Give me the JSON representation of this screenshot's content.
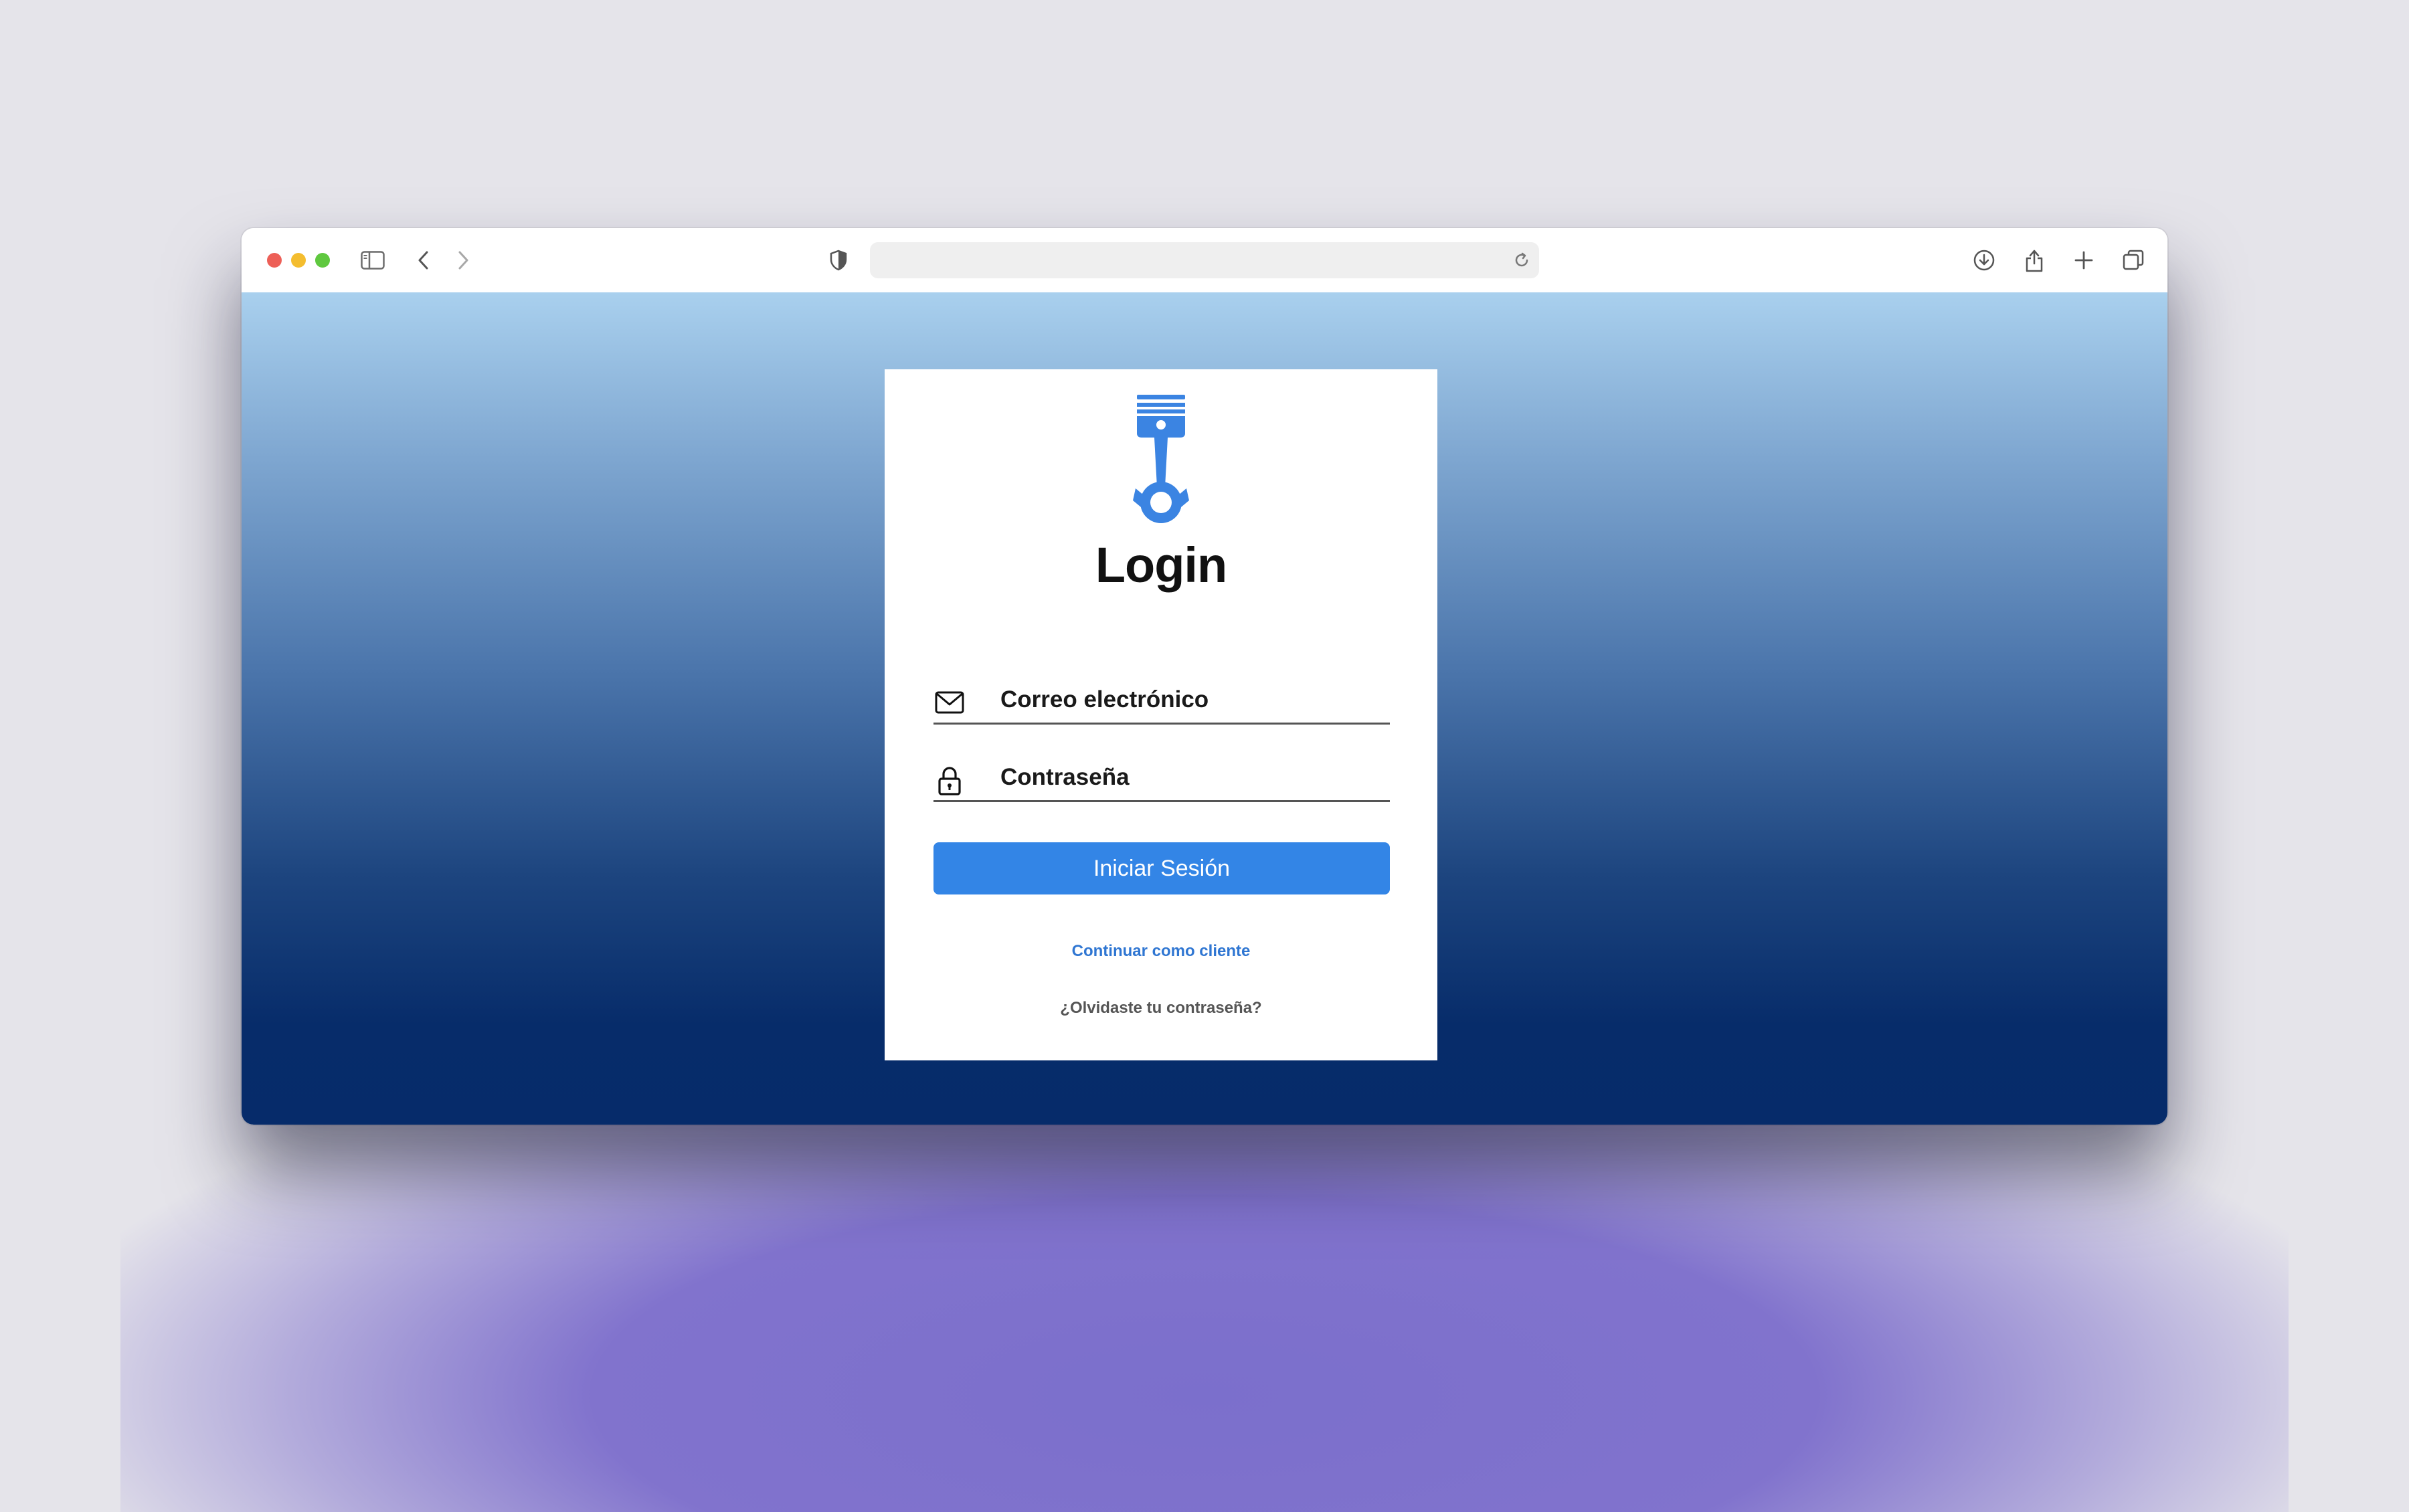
{
  "browser": {
    "url": "",
    "icons": [
      "sidebar-icon",
      "back-icon",
      "forward-icon",
      "shield-icon",
      "reload-icon",
      "download-icon",
      "share-icon",
      "new-tab-icon",
      "tabs-overview-icon"
    ]
  },
  "login": {
    "logo_icon": "piston-icon",
    "title": "Login",
    "email_label": "Correo electrónico",
    "password_label": "Contraseña",
    "submit_label": "Iniciar Sesión",
    "guest_link": "Continuar como cliente",
    "forgot_link": "¿Olvidaste tu contraseña?"
  },
  "colors": {
    "accent": "#3385e6",
    "gradient_top": "#a9d0ee",
    "gradient_bottom": "#062b6a",
    "link": "#2f76d2"
  }
}
